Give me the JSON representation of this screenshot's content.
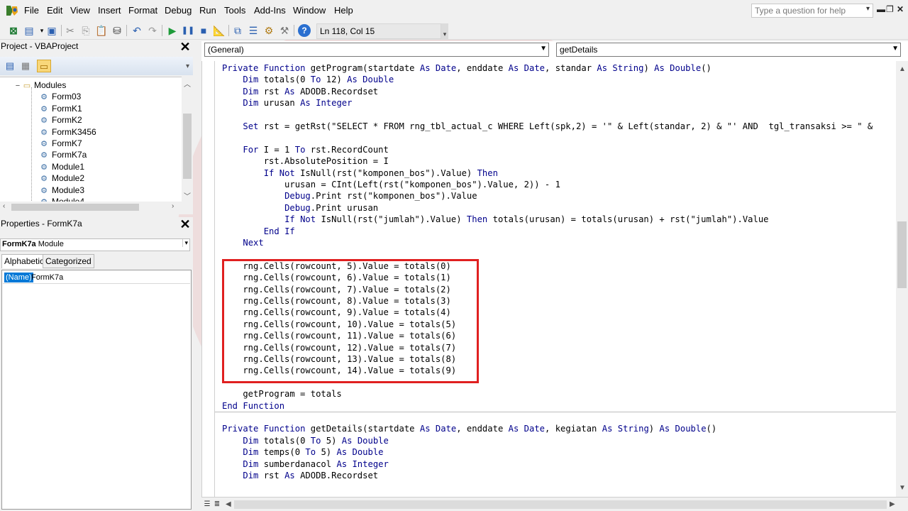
{
  "menu": {
    "items": [
      "File",
      "Edit",
      "View",
      "Insert",
      "Format",
      "Debug",
      "Run",
      "Tools",
      "Add-Ins",
      "Window",
      "Help"
    ],
    "help_placeholder": "Type a question for help"
  },
  "toolbar": {
    "position": "Ln 118, Col 15"
  },
  "project_panel": {
    "title": "Project - VBAProject",
    "tree": [
      {
        "label": "Modules",
        "kind": "folder",
        "expander": "−"
      },
      {
        "label": "Form03",
        "kind": "module"
      },
      {
        "label": "FormK1",
        "kind": "module"
      },
      {
        "label": "FormK2",
        "kind": "module"
      },
      {
        "label": "FormK3456",
        "kind": "module"
      },
      {
        "label": "FormK7",
        "kind": "module"
      },
      {
        "label": "FormK7a",
        "kind": "module"
      },
      {
        "label": "Module1",
        "kind": "module"
      },
      {
        "label": "Module2",
        "kind": "module"
      },
      {
        "label": "Module3",
        "kind": "module"
      },
      {
        "label": "Module4",
        "kind": "module"
      }
    ]
  },
  "properties_panel": {
    "title": "Properties - FormK7a",
    "object_name": "FormK7a",
    "object_type": "Module",
    "tabs": [
      "Alphabetic",
      "Categorized"
    ],
    "property_key": "(Name)",
    "property_value": "FormK7a"
  },
  "code_window": {
    "object_combo": "(General)",
    "proc_combo": "getDetails",
    "lines": [
      "Private Function getProgram(startdate As Date, enddate As Date, standar As String) As Double()",
      "    Dim totals(0 To 12) As Double",
      "    Dim rst As ADODB.Recordset",
      "    Dim urusan As Integer",
      "",
      "    Set rst = getRst(\"SELECT * FROM rng_tbl_actual_c WHERE Left(spk,2) = '\" & Left(standar, 2) & \"' AND  tgl_transaksi >= \" & ",
      "",
      "    For I = 1 To rst.RecordCount",
      "        rst.AbsolutePosition = I",
      "        If Not IsNull(rst(\"komponen_bos\").Value) Then",
      "            urusan = CInt(Left(rst(\"komponen_bos\").Value, 2)) - 1",
      "            Debug.Print rst(\"komponen_bos\").Value",
      "            Debug.Print urusan",
      "            If Not IsNull(rst(\"jumlah\").Value) Then totals(urusan) = totals(urusan) + rst(\"jumlah\").Value",
      "        End If",
      "    Next",
      "",
      "    rng.Cells(rowcount, 5).Value = totals(0)",
      "    rng.Cells(rowcount, 6).Value = totals(1)",
      "    rng.Cells(rowcount, 7).Value = totals(2)",
      "    rng.Cells(rowcount, 8).Value = totals(3)",
      "    rng.Cells(rowcount, 9).Value = totals(4)",
      "    rng.Cells(rowcount, 10).Value = totals(5)",
      "    rng.Cells(rowcount, 11).Value = totals(6)",
      "    rng.Cells(rowcount, 12).Value = totals(7)",
      "    rng.Cells(rowcount, 13).Value = totals(8)",
      "    rng.Cells(rowcount, 14).Value = totals(9)",
      "",
      "    getProgram = totals",
      "End Function",
      "",
      "Private Function getDetails(startdate As Date, enddate As Date, kegiatan As String) As Double()",
      "    Dim totals(0 To 5) As Double",
      "    Dim temps(0 To 5) As Double",
      "    Dim sumberdanacol As Integer",
      "    Dim rst As ADODB.Recordset"
    ]
  },
  "colors": {
    "keyword": "#00008b",
    "highlight": "#e02020",
    "watermark": "#d92424",
    "selection": "#0078d7"
  }
}
